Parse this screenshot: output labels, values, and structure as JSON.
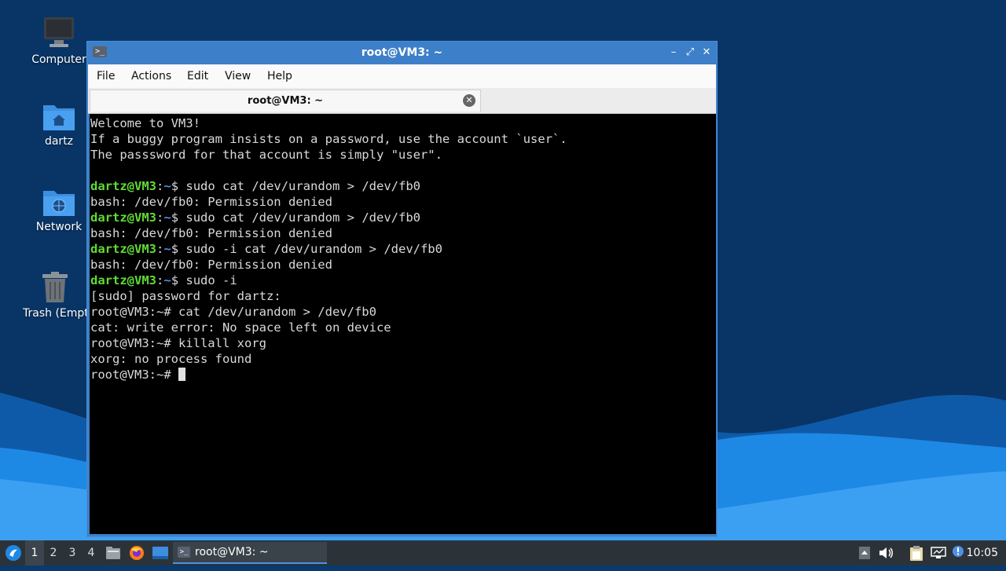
{
  "desktop": {
    "icons": [
      {
        "label": "Computer",
        "icon": "computer-icon"
      },
      {
        "label": "dartz",
        "icon": "home-folder-icon"
      },
      {
        "label": "Network",
        "icon": "network-folder-icon"
      },
      {
        "label": "Trash (Empty)",
        "icon": "trash-icon"
      }
    ],
    "wallpaper_colors": {
      "dark": "#0a3a6e",
      "mid": "#1565c0",
      "light": "#1e90ff"
    }
  },
  "window": {
    "title": "root@VM3: ~",
    "app_icon": "terminal-icon",
    "menu": [
      "File",
      "Actions",
      "Edit",
      "View",
      "Help"
    ],
    "tab": {
      "label": "root@VM3: ~"
    }
  },
  "terminal": {
    "lines": [
      {
        "text": "Welcome to VM3!"
      },
      {
        "text": "If a buggy program insists on a password, use the account `user`."
      },
      {
        "text": "The passsword for that account is simply \"user\"."
      },
      {
        "text": ""
      },
      {
        "user": "dartz@VM3",
        "path": "~",
        "sym": "$",
        "cmd": " sudo cat /dev/urandom > /dev/fb0"
      },
      {
        "text": "bash: /dev/fb0: Permission denied"
      },
      {
        "user": "dartz@VM3",
        "path": "~",
        "sym": "$",
        "cmd": " sudo cat /dev/urandom > /dev/fb0"
      },
      {
        "text": "bash: /dev/fb0: Permission denied"
      },
      {
        "user": "dartz@VM3",
        "path": "~",
        "sym": "$",
        "cmd": " sudo -i cat /dev/urandom > /dev/fb0"
      },
      {
        "text": "bash: /dev/fb0: Permission denied"
      },
      {
        "user": "dartz@VM3",
        "path": "~",
        "sym": "$",
        "cmd": " sudo -i"
      },
      {
        "text": "[sudo] password for dartz:"
      },
      {
        "text": "root@VM3:~# cat /dev/urandom > /dev/fb0"
      },
      {
        "text": "cat: write error: No space left on device"
      },
      {
        "text": "root@VM3:~# killall xorg"
      },
      {
        "text": "xorg: no process found"
      },
      {
        "text": "root@VM3:~# ",
        "cursor": true
      }
    ]
  },
  "taskbar": {
    "workspaces": [
      "1",
      "2",
      "3",
      "4"
    ],
    "active_workspace": "1",
    "task_label": "root@VM3: ~",
    "clock": "10:05",
    "tray_icons": [
      "tray-expand-icon",
      "volume-icon",
      "clipboard-icon",
      "network-monitor-icon",
      "notification-icon"
    ]
  }
}
